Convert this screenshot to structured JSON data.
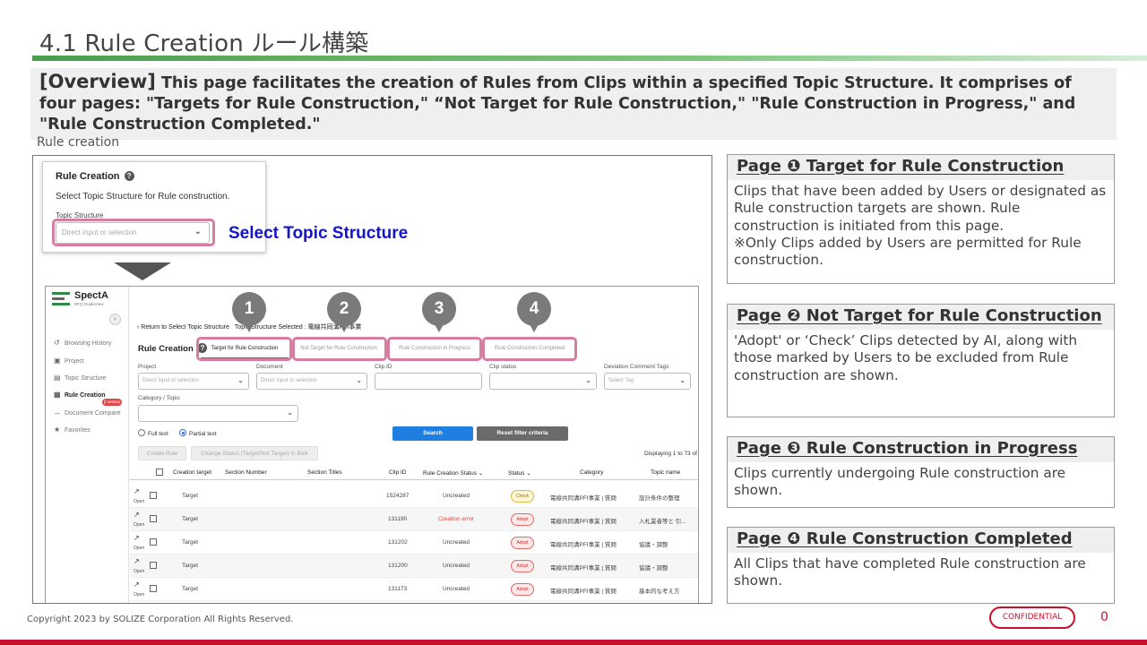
{
  "slide": {
    "title": "4.1 Rule Creation ルール構築",
    "overview_key": "[Overview]",
    "overview_text": " This page facilitates the creation of Rules from Clips within a specified Topic Structure. It comprises of four pages: \"Targets for Rule Construction,\" “Not Target for Rule Construction,\" \"Rule Construction in Progress,\" and \"Rule Construction Completed.\"",
    "caption": "Rule creation",
    "footer_copyright": "Copyright 2023 by SOLIZE Corporation All Rights Reserved.",
    "confidential": "CONFIDENTIAL",
    "page_number": "0",
    "accent_color": "#c8102e",
    "brand_green": "#4a9d4a"
  },
  "popup": {
    "title": "Rule Creation",
    "help_icon": "?",
    "subtitle": "Select Topic Structure for Rule construction.",
    "field_label": "Topic Structure",
    "placeholder": "Direct input or selection",
    "chevron": "⌄",
    "callout": "Select Topic Structure"
  },
  "app": {
    "logo_name": "SpectA",
    "logo_tag": "RFQ GuideView",
    "collapse": "‹",
    "nav": [
      {
        "icon": "↺",
        "label": "Browsing History"
      },
      {
        "icon": "▣",
        "label": "Project"
      },
      {
        "icon": "▤",
        "label": "Topic Structure"
      },
      {
        "icon": "▦",
        "label": "Rule Creation"
      },
      {
        "icon": "↔",
        "label": "Document Compare"
      },
      {
        "icon": "★",
        "label": "Favorites"
      }
    ],
    "nav_badge": "β version",
    "back_link": "Return to Select Topic Structure",
    "topic_selected": "Topic Structure Selected : 電線共同溝PFI事業",
    "page_title": "Rule Creation",
    "tabs": [
      "Target for Rule Construction",
      "Not Target for Rule Construction",
      "Rule Construction in Progress",
      "Rule Construction Completed"
    ],
    "filters": {
      "project_label": "Project",
      "document_label": "Document",
      "clip_id_label": "Clip ID",
      "clip_status_label": "Clip status",
      "deviation_label": "Deviation Comment Tags",
      "category_label": "Category / Topic",
      "select_placeholder": "Direct input or selection",
      "tag_placeholder": "Select Tag",
      "chevron": "⌄"
    },
    "radio_full": "Full text",
    "radio_partial": "Partial text",
    "search_button": "Search",
    "reset_button": "Reset filter criteria",
    "create_rule_button": "Create Rule",
    "change_status_button": "Change Status (Target/Not Target) in Bulk",
    "displaying": "Displaying 1 to 73 of",
    "columns": [
      "Creation target",
      "Section Number",
      "Section Titles",
      "Clip ID",
      "Rule Creation Status ⌄",
      "Status ⌄",
      "Category",
      "Topic name"
    ],
    "rows": [
      {
        "target": "Target",
        "clip_id": "1524287",
        "rc_status": "Uncreated",
        "status": "Check",
        "category": "電線共同溝PFI事業 | 質問",
        "topic": "設計条件の整理"
      },
      {
        "target": "Target",
        "clip_id": "131190",
        "rc_status": "Creation error",
        "status": "Adopt",
        "category": "電線共同溝PFI事業 | 質問",
        "topic": "入札業者等と 引..."
      },
      {
        "target": "Target",
        "clip_id": "131202",
        "rc_status": "Uncreated",
        "status": "Adopt",
        "category": "電線共同溝PFI事業 | 質問",
        "topic": "協議・調整"
      },
      {
        "target": "Target",
        "clip_id": "131200",
        "rc_status": "Uncreated",
        "status": "Adopt",
        "category": "電線共同溝PFI事業 | 質問",
        "topic": "協議・調整"
      },
      {
        "target": "Target",
        "clip_id": "131173",
        "rc_status": "Uncreated",
        "status": "Adopt",
        "category": "電線共同溝PFI事業 | 質問",
        "topic": "基本的な考え方"
      }
    ],
    "expand_icon": "↗",
    "open_label": "Open",
    "markers": [
      "1",
      "2",
      "3",
      "4"
    ]
  },
  "panels": [
    {
      "title": "Page ❶ Target for Rule Construction",
      "body": "Clips that have been added by Users or designated as Rule construction targets are shown. Rule construction is initiated from this page.\n※Only Clips added by Users are permitted for Rule construction."
    },
    {
      "title": "Page ❷ Not Target for Rule Construction",
      "body": "'Adopt' or ‘Check’ Clips detected by AI, along with those marked by Users to be excluded from Rule construction are shown."
    },
    {
      "title": "Page ❸ Rule Construction in Progress",
      "body": "Clips currently undergoing Rule construction are shown."
    },
    {
      "title": "Page ❹ Rule Construction Completed",
      "body": "All Clips that have completed Rule construction are shown."
    }
  ]
}
